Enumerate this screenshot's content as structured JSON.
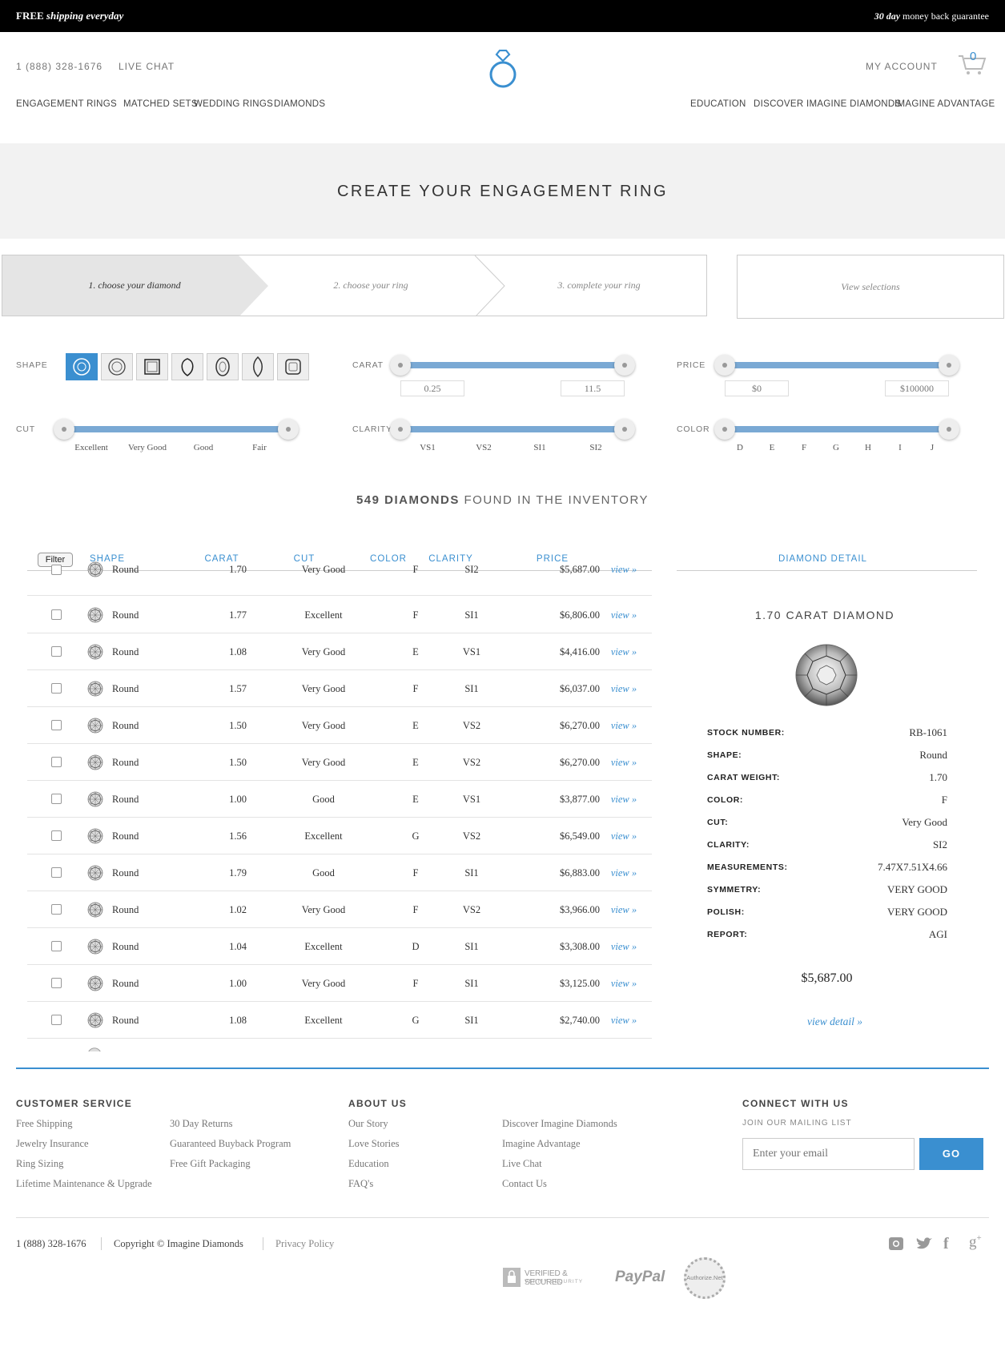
{
  "topbar": {
    "left_bold": "FREE",
    "left_italic": "shipping everyday",
    "right_italic": "30 day",
    "right_rest": "money back guarantee"
  },
  "header": {
    "phone": "1 (888) 328-1676",
    "live_chat": "LIVE CHAT",
    "my_account": "MY ACCOUNT",
    "cart_count": "0",
    "nav_left": [
      "ENGAGEMENT RINGS",
      "MATCHED SETS",
      "WEDDING RINGS",
      "DIAMONDS"
    ],
    "nav_right": [
      "EDUCATION",
      "DISCOVER IMAGINE DIAMONDS",
      "IMAGINE ADVANTAGE"
    ]
  },
  "hero": {
    "title": "CREATE YOUR ENGAGEMENT RING"
  },
  "steps": [
    "1. choose your diamond",
    "2. choose your ring",
    "3. complete your ring"
  ],
  "view_selections": "View selections",
  "filters": {
    "shape_label": "SHAPE",
    "carat_label": "CARAT",
    "price_label": "PRICE",
    "cut_label": "CUT",
    "clarity_label": "CLARITY",
    "color_label": "COLOR",
    "shapes": [
      "round-icon",
      "cushion-icon",
      "princess-icon",
      "pear-icon",
      "oval-icon",
      "marquise-icon",
      "asscher-icon"
    ],
    "carat_min": "0.25",
    "carat_max": "11.5",
    "price_min": "$0",
    "price_max": "$100000",
    "cut_ticks": [
      "Excellent",
      "Very Good",
      "Good",
      "Fair"
    ],
    "clarity_ticks": [
      "VS1",
      "VS2",
      "SI1",
      "SI2"
    ],
    "color_ticks": [
      "D",
      "E",
      "F",
      "G",
      "H",
      "I",
      "J"
    ]
  },
  "inventory": {
    "count_bold": "549 DIAMONDS",
    "count_rest": "FOUND IN THE INVENTORY",
    "filter_btn": "Filter",
    "headers": [
      "SHAPE",
      "CARAT",
      "CUT",
      "COLOR",
      "CLARITY",
      "PRICE"
    ],
    "view_label": "view »",
    "rows": [
      [
        "Round",
        "1.70",
        "Very Good",
        "F",
        "SI2",
        "$5,687.00"
      ],
      [
        "Round",
        "1.77",
        "Excellent",
        "F",
        "SI1",
        "$6,806.00"
      ],
      [
        "Round",
        "1.08",
        "Very Good",
        "E",
        "VS1",
        "$4,416.00"
      ],
      [
        "Round",
        "1.57",
        "Very Good",
        "F",
        "SI1",
        "$6,037.00"
      ],
      [
        "Round",
        "1.50",
        "Very Good",
        "E",
        "VS2",
        "$6,270.00"
      ],
      [
        "Round",
        "1.50",
        "Very Good",
        "E",
        "VS2",
        "$6,270.00"
      ],
      [
        "Round",
        "1.00",
        "Good",
        "E",
        "VS1",
        "$3,877.00"
      ],
      [
        "Round",
        "1.56",
        "Excellent",
        "G",
        "VS2",
        "$6,549.00"
      ],
      [
        "Round",
        "1.79",
        "Good",
        "F",
        "SI1",
        "$6,883.00"
      ],
      [
        "Round",
        "1.02",
        "Very Good",
        "F",
        "VS2",
        "$3,966.00"
      ],
      [
        "Round",
        "1.04",
        "Excellent",
        "D",
        "SI1",
        "$3,308.00"
      ],
      [
        "Round",
        "1.00",
        "Very Good",
        "F",
        "SI1",
        "$3,125.00"
      ],
      [
        "Round",
        "1.08",
        "Excellent",
        "G",
        "SI1",
        "$2,740.00"
      ]
    ]
  },
  "detail": {
    "header": "DIAMOND DETAIL",
    "title": "1.70 CARAT DIAMOND",
    "specs": [
      {
        "label": "STOCK NUMBER:",
        "value": "RB-1061"
      },
      {
        "label": "SHAPE:",
        "value": "Round"
      },
      {
        "label": "CARAT WEIGHT:",
        "value": "1.70"
      },
      {
        "label": "COLOR:",
        "value": "F"
      },
      {
        "label": "CUT:",
        "value": "Very Good"
      },
      {
        "label": "CLARITY:",
        "value": "SI2"
      },
      {
        "label": "MEASUREMENTS:",
        "value": "7.47X7.51X4.66"
      },
      {
        "label": "SYMMETRY:",
        "value": "VERY GOOD"
      },
      {
        "label": "POLISH:",
        "value": "VERY GOOD"
      },
      {
        "label": "REPORT:",
        "value": "AGI"
      }
    ],
    "price": "$5,687.00",
    "view_detail": "view detail »"
  },
  "footer": {
    "customer_service": "CUSTOMER SERVICE",
    "about_us": "ABOUT US",
    "connect": "CONNECT WITH US",
    "mailing": "JOIN OUR MAILING LIST",
    "cs_col1": [
      "Free Shipping",
      "Jewelry Insurance",
      "Ring Sizing",
      "Lifetime Maintenance & Upgrade"
    ],
    "cs_col2": [
      "30 Day Returns",
      "Guaranteed Buyback Program",
      "Free Gift Packaging"
    ],
    "about_col1": [
      "Our Story",
      "Love Stories",
      "Education",
      "FAQ's"
    ],
    "about_col2": [
      "Discover Imagine Diamonds",
      "Imagine Advantage",
      "Live Chat",
      "Contact Us"
    ],
    "email_placeholder": "Enter your email",
    "go": "GO",
    "phone": "1 (888) 328-1676",
    "copyright": "Copyright © Imagine Diamonds",
    "privacy": "Privacy Policy",
    "badge_verified": "VERIFIED & SECURED",
    "badge_verified_sub": "VERIFY SECURITY",
    "paypal": "PayPal",
    "authorize": "Authorize.Net"
  },
  "colors": {
    "accent": "#3a8fd0",
    "slider": "#7aa9d4"
  }
}
